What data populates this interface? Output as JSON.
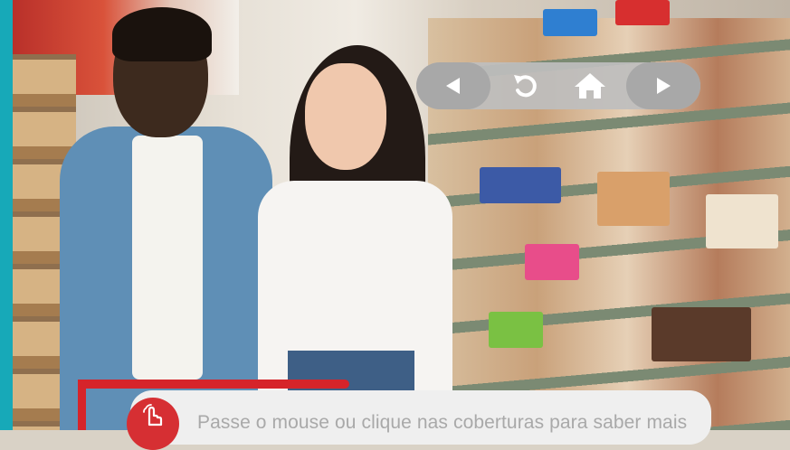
{
  "navigation": {
    "previous": {
      "icon": "chevron-left-icon"
    },
    "reload": {
      "icon": "reload-icon"
    },
    "home": {
      "icon": "home-icon"
    },
    "next": {
      "icon": "chevron-right-icon"
    }
  },
  "hint": {
    "icon": "hand-pointer-icon",
    "text": "Passe o mouse ou clique nas coberturas para saber mais"
  },
  "colors": {
    "accent_bar": "#17a9b8",
    "nav_pill": "#bebebe",
    "nav_button": "#a8a8a8",
    "hint_background": "#efefef",
    "hint_icon": "#d62f33",
    "hint_text": "#a9a9a9"
  }
}
